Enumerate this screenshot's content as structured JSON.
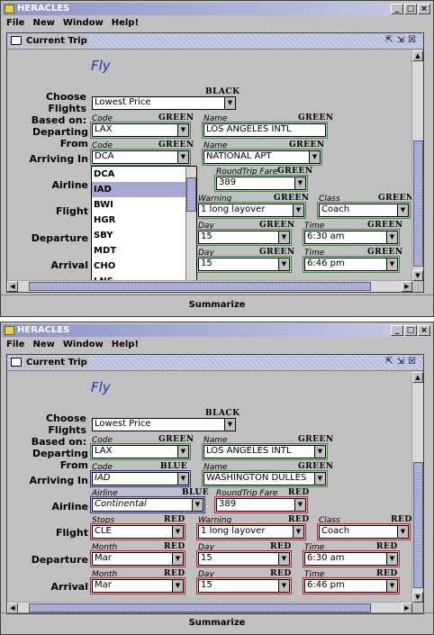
{
  "screens": [
    {
      "title": "HERACLES",
      "menu": [
        "File",
        "New",
        "Window",
        "Help!"
      ],
      "window_title": "Current Trip",
      "heading": "Fly",
      "summarize": "Summarize",
      "labels": {
        "choose1": "Choose Flights",
        "choose2": "Based on:",
        "departing": "Departing From",
        "arriving": "Arriving In",
        "airline": "Airline",
        "flight": "Flight",
        "departure": "Departure",
        "arrival": "Arrival"
      },
      "fields": {
        "based_on": {
          "tag": "BLACK",
          "value": "Lowest Price"
        },
        "dep_code": {
          "cap": "Code",
          "tag": "GREEN",
          "value": "LAX"
        },
        "dep_name": {
          "cap": "Name",
          "tag": "GREEN",
          "value": "LOS ANGELES INTL"
        },
        "arr_code": {
          "cap": "Code",
          "tag": "GREEN",
          "value": "DCA"
        },
        "arr_name": {
          "cap": "Name",
          "tag": "GREEN",
          "value": "NATIONAL APT"
        },
        "fare": {
          "cap": "RoundTrip Fare",
          "tag": "GREEN",
          "value": "389"
        },
        "warning": {
          "cap": "Warning",
          "tag": "GREEN",
          "value": "1 long layover"
        },
        "class": {
          "cap": "Class",
          "tag": "GREEN",
          "value": "Coach"
        },
        "dep_day": {
          "cap": "Day",
          "tag": "GREEN",
          "value": "15"
        },
        "dep_time": {
          "cap": "Time",
          "tag": "GREEN",
          "value": "6:30 am"
        },
        "arr_day": {
          "cap": "Day",
          "tag": "GREEN",
          "value": "15"
        },
        "arr_time": {
          "cap": "Time",
          "tag": "GREEN",
          "value": "6:46 pm"
        }
      },
      "dropdown": [
        "DCA",
        "IAD",
        "BWI",
        "HGR",
        "SBY",
        "MDT",
        "CHO",
        "LNS"
      ],
      "dropdown_selected": "IAD"
    },
    {
      "title": "HERACLES",
      "menu": [
        "File",
        "New",
        "Window",
        "Help!"
      ],
      "window_title": "Current Trip",
      "heading": "Fly",
      "summarize": "Summarize",
      "labels": {
        "choose1": "Choose Flights",
        "choose2": "Based on:",
        "departing": "Departing From",
        "arriving": "Arriving In",
        "airline": "Airline",
        "flight": "Flight",
        "departure": "Departure",
        "arrival": "Arrival"
      },
      "fields": {
        "based_on": {
          "tag": "BLACK",
          "value": "Lowest Price"
        },
        "dep_code": {
          "cap": "Code",
          "tag": "GREEN",
          "value": "LAX"
        },
        "dep_name": {
          "cap": "Name",
          "tag": "GREEN",
          "value": "LOS ANGELES INTL"
        },
        "arr_code": {
          "cap": "Code",
          "tag": "BLUE",
          "value": "IAD"
        },
        "arr_name": {
          "cap": "Name",
          "tag": "GREEN",
          "value": "WASHINGTON DULLES"
        },
        "airline": {
          "cap": "Airline",
          "tag": "BLUE",
          "value": "Continental"
        },
        "fare": {
          "cap": "RoundTrip Fare",
          "tag": "RED",
          "value": "389"
        },
        "stops": {
          "cap": "Stops",
          "tag": "RED",
          "value": "CLE"
        },
        "warning": {
          "cap": "Warning",
          "tag": "RED",
          "value": "1 long layover"
        },
        "class": {
          "cap": "Class",
          "tag": "RED",
          "value": "Coach"
        },
        "dep_month": {
          "cap": "Month",
          "tag": "RED",
          "value": "Mar"
        },
        "dep_day": {
          "cap": "Day",
          "tag": "RED",
          "value": "15"
        },
        "dep_time": {
          "cap": "Time",
          "tag": "RED",
          "value": "6:30 am"
        },
        "arr_month": {
          "cap": "Month",
          "tag": "RED",
          "value": "Mar"
        },
        "arr_day": {
          "cap": "Day",
          "tag": "RED",
          "value": "15"
        },
        "arr_time": {
          "cap": "Time",
          "tag": "RED",
          "value": "6:46 pm"
        }
      }
    }
  ],
  "colors": {
    "green": "#2a9a2a",
    "red": "#d02020",
    "blue": "#2030b8",
    "black": "#000000",
    "heading": "#2633c0",
    "selection": "#a7a9d4"
  }
}
